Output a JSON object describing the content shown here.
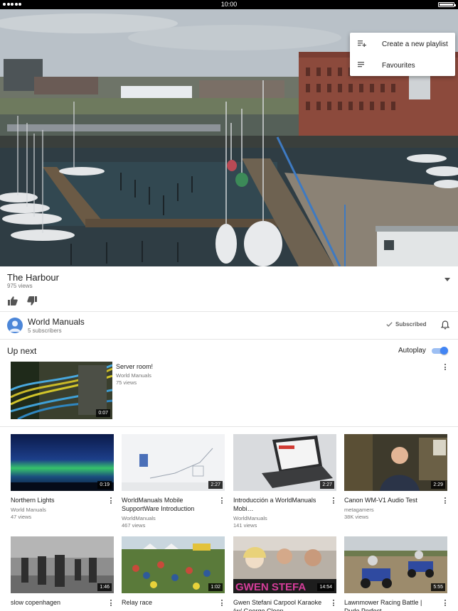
{
  "status_bar": {
    "time": "10:00"
  },
  "menu": {
    "items": [
      {
        "label": "Create a new playlist"
      },
      {
        "label": "Favourites"
      }
    ]
  },
  "video": {
    "title": "The Harbour",
    "views": "975 views"
  },
  "channel": {
    "name": "World Manuals",
    "subscribers": "5 subscribers",
    "subscribed_label": "Subscribed"
  },
  "up_next": {
    "heading": "Up next",
    "autoplay_label": "Autoplay",
    "autoplay_on": true,
    "featured": {
      "title": "Server room!",
      "channel": "World Manuals",
      "views": "75 views",
      "duration": "0:07"
    }
  },
  "videos": [
    {
      "title": "Northern Lights",
      "channel": "World Manuals",
      "views": "47 views",
      "duration": "0:19"
    },
    {
      "title": "WorldManuals Mobile SupportWare Introduction",
      "channel": "WorldManuals",
      "views": "467 views",
      "duration": "2:27"
    },
    {
      "title": "Introducción a WorldManuals Mobi…",
      "channel": "WorldManuals",
      "views": "141 views",
      "duration": "2:27"
    },
    {
      "title": "Canon WM-V1 Audio Test",
      "channel": "metagamers",
      "views": "38K views",
      "duration": "2:29"
    },
    {
      "title": "slow copenhagen",
      "channel": "",
      "views": "",
      "duration": "1:46"
    },
    {
      "title": "Relay race",
      "channel": "",
      "views": "",
      "duration": "1:02"
    },
    {
      "title": "Gwen Stefani Carpool Karaoke (w/ George Cloon…",
      "channel": "",
      "views": "",
      "duration": "14:54",
      "overlay_text": "GWEN STEFA"
    },
    {
      "title": "Lawnmower Racing Battle | Dude Perfect",
      "channel": "",
      "views": "",
      "duration": "5:55"
    }
  ],
  "colors": {
    "accent": "#4285f4",
    "avatar": "#4c86d8"
  }
}
